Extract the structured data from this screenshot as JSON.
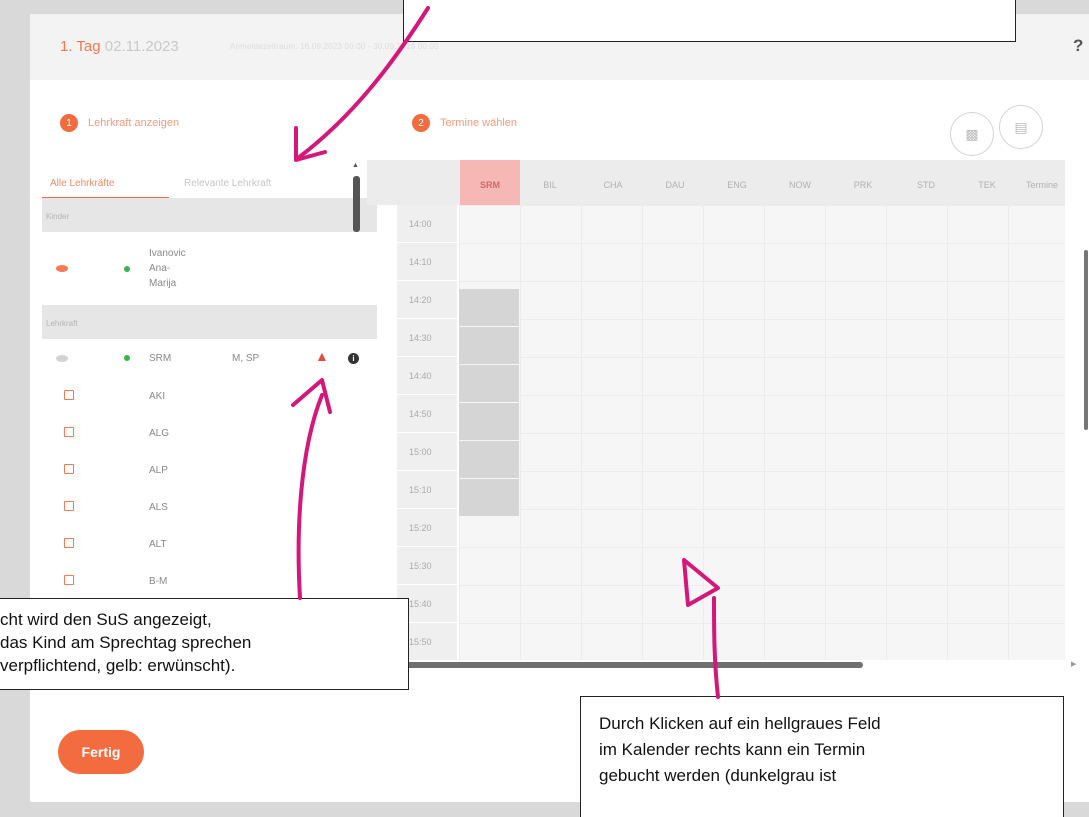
{
  "header": {
    "day": "1. Tag",
    "date": "02.11.2023",
    "range": "Anmeldezeitraum: 16.09.2023 00:00 - 30.09.2023 00:00",
    "help": "?"
  },
  "steps": [
    {
      "num": "1",
      "label": "Lehrkraft anzeigen"
    },
    {
      "num": "2",
      "label": "Termine wählen"
    }
  ],
  "tabs": [
    {
      "label": "Alle Lehrkräfte",
      "active": true
    },
    {
      "label": "Relevante Lehrkraft",
      "active": false
    }
  ],
  "list": {
    "group_children": "Kinder",
    "child": {
      "name_line1": "Ivanovic",
      "name_line2": "Ana-",
      "name_line3": "Marija"
    },
    "group_teacher": "Lehrkraft",
    "teacher_row": {
      "code": "SRM",
      "subjects": "M, SP",
      "info": "i"
    },
    "teachers": [
      "AKI",
      "ALG",
      "ALP",
      "ALS",
      "ALT",
      "B-M"
    ]
  },
  "calendar": {
    "columns": [
      "SRM",
      "BIL",
      "CHA",
      "DAU",
      "ENG",
      "NOW",
      "PRK",
      "STD",
      "TEK",
      "Termine"
    ],
    "times": [
      "14:00",
      "14:10",
      "14:20",
      "14:30",
      "14:40",
      "14:50",
      "15:00",
      "15:10",
      "15:20",
      "15:30",
      "15:40",
      "15:50"
    ],
    "selected_column": "SRM"
  },
  "buttons": {
    "done": "Fertig"
  },
  "callouts": {
    "top": "",
    "left_line1": "cht wird den SuS angezeigt,",
    "left_line2": " das Kind am Sprechtag sprechen",
    "left_line3": " verpflichtend, gelb: erwünscht).",
    "right_line1": "Durch Klicken auf ein hellgraues Feld",
    "right_line2": "im Kalender rechts kann ein Termin",
    "right_line3": "gebucht werden (dunkelgrau ist"
  },
  "colors": {
    "accent": "#f26c3f",
    "annotation": "#d6177a",
    "busy": "#d5d5d5"
  }
}
